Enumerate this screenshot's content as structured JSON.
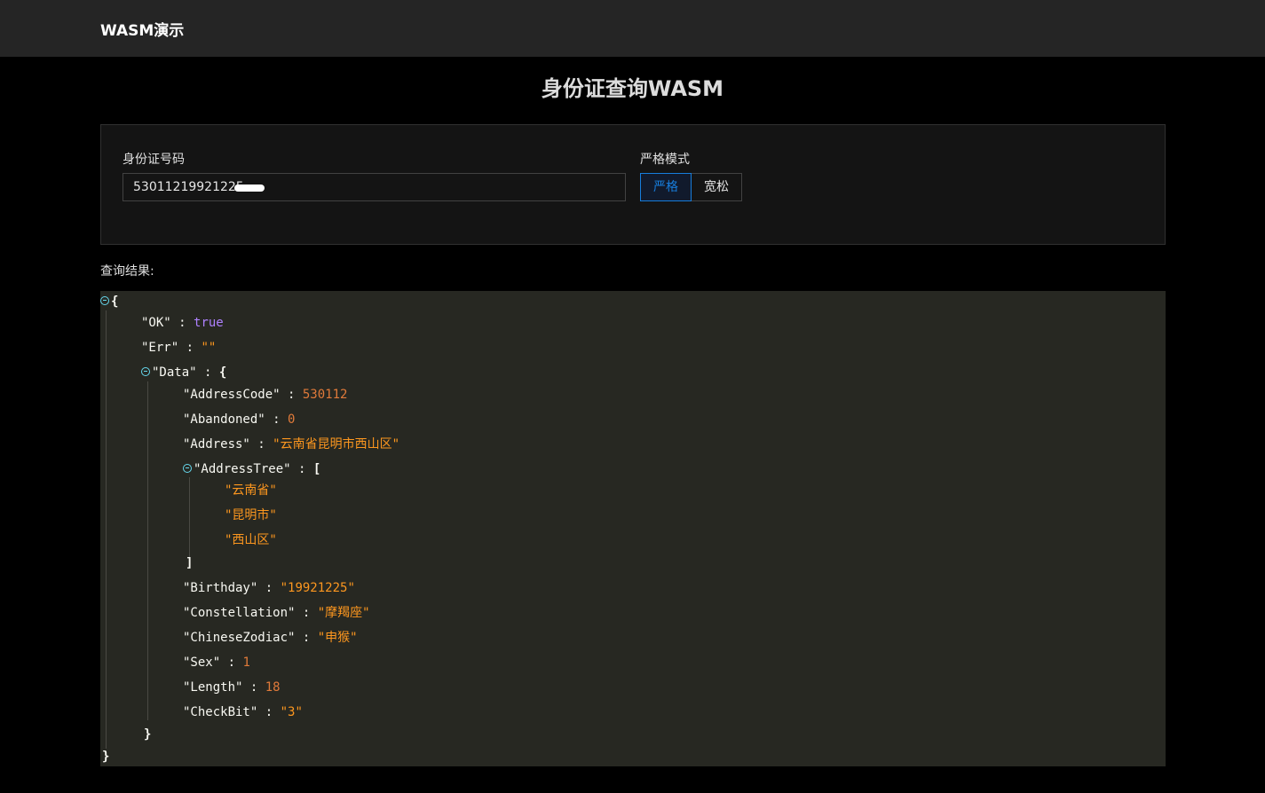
{
  "header": {
    "brand": "WASM演示"
  },
  "page": {
    "title": "身份证查询WASM"
  },
  "form": {
    "id_label": "身份证号码",
    "id_value": "53011219921225",
    "mode_label": "严格模式",
    "modes": [
      {
        "label": "严格",
        "selected": true
      },
      {
        "label": "宽松",
        "selected": false
      }
    ]
  },
  "result": {
    "label": "查询结果:",
    "json": {
      "OK": "true",
      "Err": "\"\"",
      "data_key": "\"Data\"",
      "AddressCode": "530112",
      "Abandoned": "0",
      "Address": "\"云南省昆明市西山区\"",
      "tree_key": "\"AddressTree\"",
      "AddressTree": [
        "\"云南省\"",
        "\"昆明市\"",
        "\"西山区\""
      ],
      "Birthday": "\"19921225\"",
      "Constellation": "\"摩羯座\"",
      "ChineseZodiac": "\"申猴\"",
      "Sex": "1",
      "Length": "18",
      "CheckBit": "\"3\""
    }
  },
  "colors": {
    "key": "#f8f8f2",
    "string": "#fd971f",
    "number": "#e07a3a",
    "boolean": "#ae81ff",
    "accent": "#177ddc",
    "viewer_bg": "#272822"
  }
}
